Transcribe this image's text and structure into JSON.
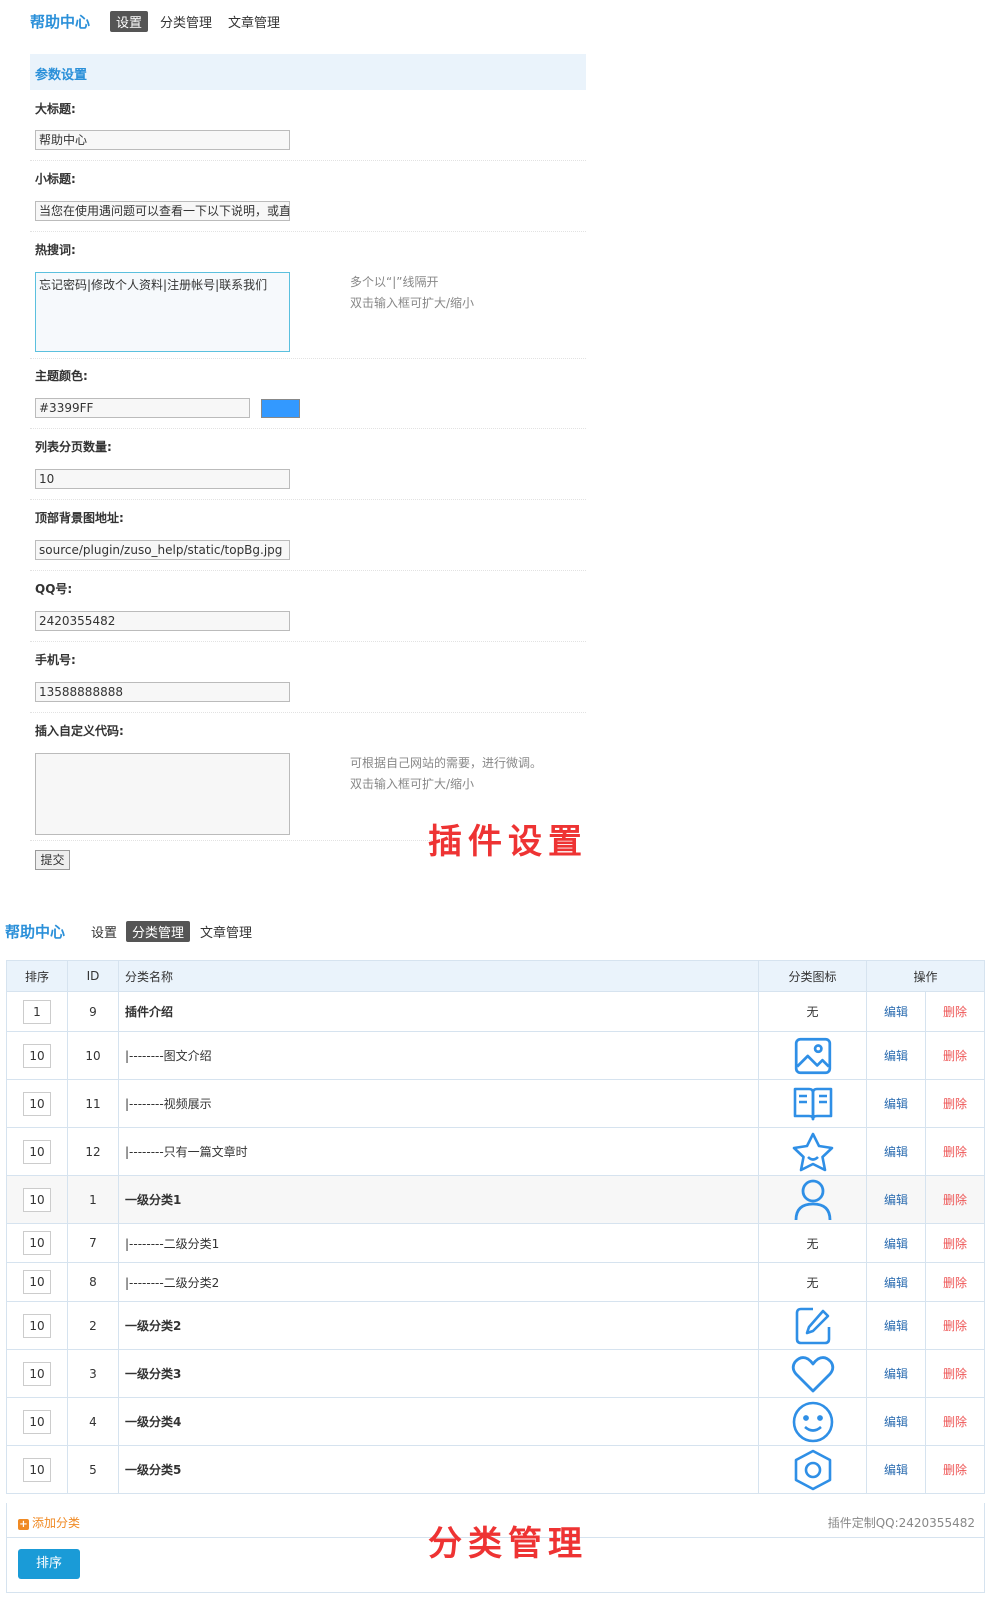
{
  "top_nav": {
    "brand": "帮助中心",
    "tabs": [
      {
        "label": "设置",
        "active": true
      },
      {
        "label": "分类管理",
        "active": false
      },
      {
        "label": "文章管理",
        "active": false
      }
    ]
  },
  "settings": {
    "section_title": "参数设置",
    "fields": {
      "title_label": "大标题:",
      "title_value": "帮助中心",
      "subtitle_label": "小标题:",
      "subtitle_value": "当您在使用遇问题可以查看一下以下说明，或直",
      "hotwords_label": "热搜词:",
      "hotwords_value": "忘记密码|修改个人资料|注册帐号|联系我们",
      "hotwords_tip1": "多个以“|”线隔开",
      "hotwords_tip2": "双击输入框可扩大/缩小",
      "color_label": "主题颜色:",
      "color_value": "#3399FF",
      "pagesize_label": "列表分页数量:",
      "pagesize_value": "10",
      "topbg_label": "顶部背景图地址:",
      "topbg_value": "source/plugin/zuso_help/static/topBg.jpg",
      "qq_label": "QQ号:",
      "qq_value": "2420355482",
      "phone_label": "手机号:",
      "phone_value": "13588888888",
      "code_label": "插入自定义代码:",
      "code_value": "",
      "code_tip1": "可根据自己网站的需要，进行微调。",
      "code_tip2": "双击输入框可扩大/缩小"
    },
    "submit_label": "提交",
    "watermark": "插件设置"
  },
  "category_nav": {
    "brand": "帮助中心",
    "tabs": [
      {
        "label": "设置",
        "active": false
      },
      {
        "label": "分类管理",
        "active": true
      },
      {
        "label": "文章管理",
        "active": false
      }
    ]
  },
  "category_table": {
    "headers": [
      "排序",
      "ID",
      "分类名称",
      "分类图标",
      "操作"
    ],
    "rows": [
      {
        "order": "1",
        "id": "9",
        "name": "插件介绍",
        "bold": true,
        "icon": "none",
        "icon_text": "无",
        "edit": "编辑",
        "delete": "删除"
      },
      {
        "order": "10",
        "id": "10",
        "name": "|--------图文介绍",
        "bold": false,
        "icon": "image-icon",
        "icon_text": "",
        "edit": "编辑",
        "delete": "删除"
      },
      {
        "order": "10",
        "id": "11",
        "name": "|--------视频展示",
        "bold": false,
        "icon": "book-icon",
        "icon_text": "",
        "edit": "编辑",
        "delete": "删除"
      },
      {
        "order": "10",
        "id": "12",
        "name": "|--------只有一篇文章时",
        "bold": false,
        "icon": "star-icon",
        "icon_text": "",
        "edit": "编辑",
        "delete": "删除"
      },
      {
        "order": "10",
        "id": "1",
        "name": "一级分类1",
        "bold": true,
        "icon": "user-icon",
        "icon_text": "",
        "edit": "编辑",
        "delete": "删除",
        "highlight": true
      },
      {
        "order": "10",
        "id": "7",
        "name": "|--------二级分类1",
        "bold": false,
        "icon": "none",
        "icon_text": "无",
        "edit": "编辑",
        "delete": "删除"
      },
      {
        "order": "10",
        "id": "8",
        "name": "|--------二级分类2",
        "bold": false,
        "icon": "none",
        "icon_text": "无",
        "edit": "编辑",
        "delete": "删除"
      },
      {
        "order": "10",
        "id": "2",
        "name": "一级分类2",
        "bold": true,
        "icon": "edit-icon",
        "icon_text": "",
        "edit": "编辑",
        "delete": "删除"
      },
      {
        "order": "10",
        "id": "3",
        "name": "一级分类3",
        "bold": true,
        "icon": "heart-icon",
        "icon_text": "",
        "edit": "编辑",
        "delete": "删除"
      },
      {
        "order": "10",
        "id": "4",
        "name": "一级分类4",
        "bold": true,
        "icon": "smile-icon",
        "icon_text": "",
        "edit": "编辑",
        "delete": "删除"
      },
      {
        "order": "10",
        "id": "5",
        "name": "一级分类5",
        "bold": true,
        "icon": "hexagon-icon",
        "icon_text": "",
        "edit": "编辑",
        "delete": "删除"
      }
    ],
    "add_label": "添加分类",
    "custom_text": "插件定制QQ:2420355482",
    "sort_button": "排序",
    "watermark": "分类管理"
  },
  "colors": {
    "accent": "#2b90d9",
    "icon_blue": "#2f8fe6",
    "theme_swatch": "#3399FF",
    "watermark_red": "#ee3333",
    "add_orange": "#f08a24"
  }
}
